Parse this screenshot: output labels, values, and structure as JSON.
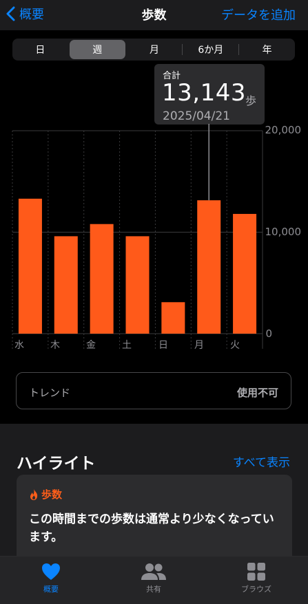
{
  "nav": {
    "back_label": "概要",
    "title": "歩数",
    "add_label": "データを追加"
  },
  "segments": [
    "日",
    "週",
    "月",
    "6か月",
    "年"
  ],
  "selected_segment": "週",
  "tooltip": {
    "label": "合計",
    "value": "13,143",
    "unit": "歩",
    "date": "2025/04/21"
  },
  "chart_data": {
    "type": "bar",
    "categories": [
      "水",
      "木",
      "金",
      "土",
      "日",
      "月",
      "火"
    ],
    "values": [
      13300,
      9600,
      10800,
      9600,
      3100,
      13143,
      11800
    ],
    "y_ticks": [
      "20,000",
      "10,000",
      "0"
    ],
    "ylim": [
      0,
      20000
    ],
    "bar_color": "#ff5a1a",
    "highlighted_index": 5
  },
  "trend": {
    "label": "トレンド",
    "value": "使用不可"
  },
  "highlights": {
    "title": "ハイライト",
    "show_all": "すべて表示",
    "card": {
      "category": "歩数",
      "text": "この時間までの歩数は通常より少なくなっています。"
    }
  },
  "tabs": [
    {
      "label": "概要",
      "icon": "heart-icon",
      "active": true
    },
    {
      "label": "共有",
      "icon": "people-icon",
      "active": false
    },
    {
      "label": "ブラウズ",
      "icon": "grid-icon",
      "active": false
    }
  ],
  "colors": {
    "accent": "#0a84ff",
    "bar": "#ff5a1a",
    "inactive": "#8e8e93"
  }
}
